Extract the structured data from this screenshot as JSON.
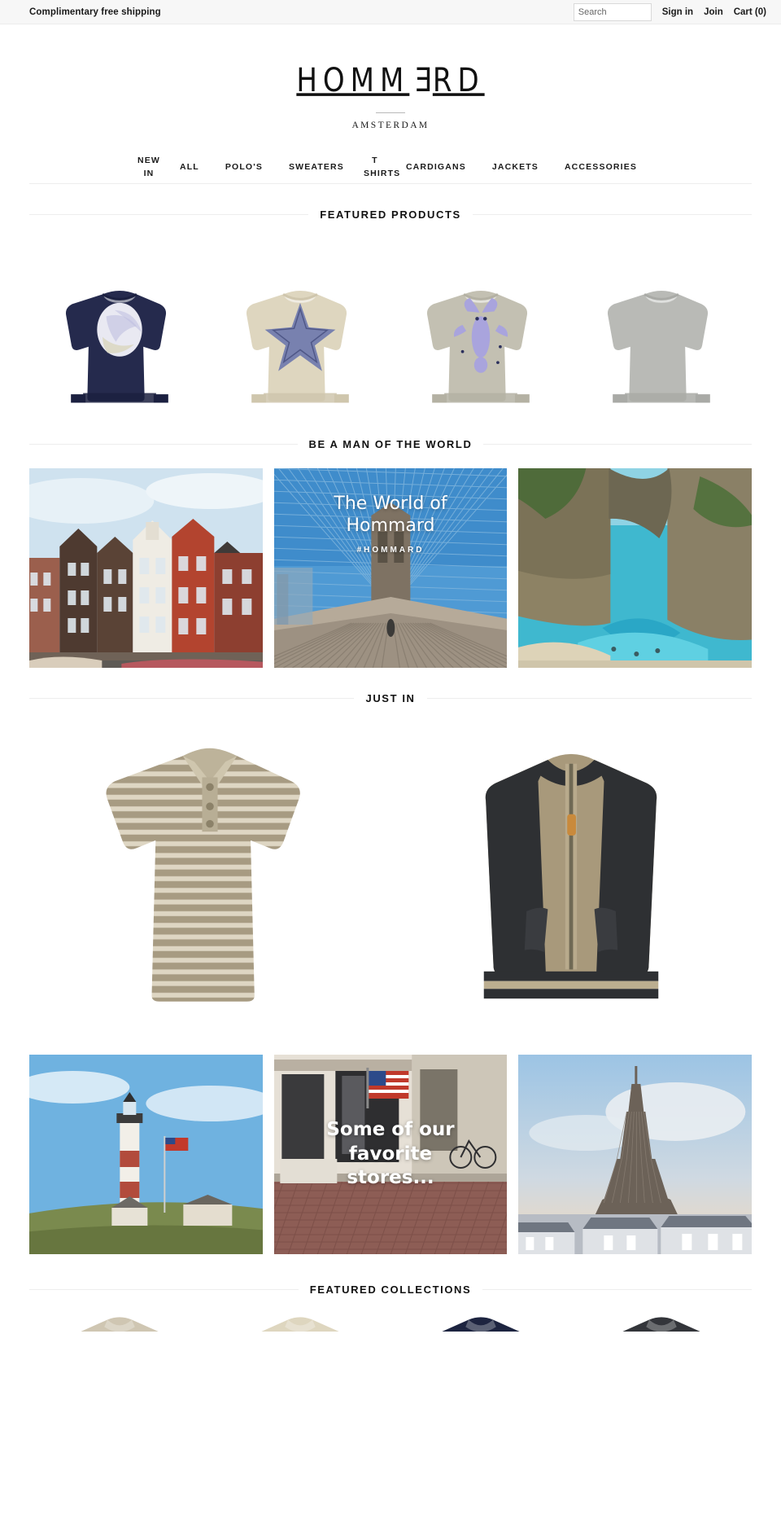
{
  "topbar": {
    "message": "Complimentary free shipping",
    "search_placeholder": "Search",
    "search_value": "",
    "links": [
      {
        "label": "Sign in",
        "name": "sign-in-link"
      },
      {
        "label": "Join",
        "name": "join-link"
      },
      {
        "label": "Cart (0)",
        "name": "cart-link"
      }
    ]
  },
  "brand": {
    "logo_before": "HOMM",
    "logo_flip": "E",
    "logo_after": "RD",
    "tagline": "AMSTERDAM"
  },
  "nav": {
    "items": [
      {
        "label": "NEW IN",
        "two_line": true
      },
      {
        "label": "ALL",
        "two_line": false
      },
      {
        "label": "POLO'S",
        "two_line": false
      },
      {
        "label": "SWEATERS",
        "two_line": false
      },
      {
        "label": "T SHIRTS",
        "two_line": true
      },
      {
        "label": "CARDIGANS",
        "two_line": false
      },
      {
        "label": "JACKETS",
        "two_line": false
      },
      {
        "label": "ACCESSORIES",
        "two_line": false
      }
    ]
  },
  "sections": {
    "featured_products": "FEATURED PRODUCTS",
    "be_a_man": "BE A MAN OF THE WORLD",
    "just_in": "JUST IN",
    "featured_collections": "FEATURED COLLECTIONS"
  },
  "featured_products": [
    {
      "name": "navy-moon-sweater",
      "alt": "Navy crew neck sweater with moon motif",
      "body": "#252a4d",
      "trim": "#1b2040",
      "motif": "moon"
    },
    {
      "name": "cream-starfish-sweater",
      "alt": "Cream crew neck sweater with starfish motif",
      "body": "#ded6bf",
      "trim": "#cfc6ad",
      "motif": "starfish"
    },
    {
      "name": "grey-lobster-sweater",
      "alt": "Grey crew neck sweater with lobster motif",
      "body": "#c3c0b2",
      "trim": "#b4b1a3",
      "motif": "lobster"
    },
    {
      "name": "grey-plain-sweater",
      "alt": "Grey marl plain crew neck sweater",
      "body": "#b9bab6",
      "trim": "#a9aaa6",
      "motif": "none"
    }
  ],
  "world_tiles": [
    {
      "name": "amsterdam-canal-houses",
      "alt": "Amsterdam canal houses",
      "title": "",
      "subtitle": ""
    },
    {
      "name": "brooklyn-bridge",
      "alt": "Brooklyn Bridge walkway",
      "title": "The World of Hommard",
      "subtitle": "#HOMMARD"
    },
    {
      "name": "coastal-arch-beach",
      "alt": "Coastal rock arch with turquoise water",
      "title": "",
      "subtitle": ""
    }
  ],
  "just_in": [
    {
      "name": "striped-polo-shirt",
      "alt": "Beige and cream striped short sleeve polo shirt"
    },
    {
      "name": "two-tone-zip-cardigan",
      "alt": "Tan and charcoal zip bomber cardigan"
    }
  ],
  "store_tiles": [
    {
      "name": "montauk-lighthouse",
      "alt": "Montauk lighthouse with American flag",
      "title": "",
      "subtitle": ""
    },
    {
      "name": "murrays-toggery-shop",
      "alt": "Murray's Toggery Shop storefront with American flag",
      "title": "Some of our favorite stores...",
      "subtitle": ""
    },
    {
      "name": "paris-eiffel-tower",
      "alt": "Eiffel Tower over Paris rooftops",
      "title": "",
      "subtitle": ""
    }
  ],
  "featured_collections": [
    {
      "name": "collection-polo-shirt",
      "alt": "Beige polo shirt collar",
      "body": "#cfc6b2"
    },
    {
      "name": "collection-cream-sweater",
      "alt": "Cream sweater neckline",
      "body": "#ded6bf"
    },
    {
      "name": "collection-navy-item",
      "alt": "Navy knit neckline",
      "body": "#1d2440"
    },
    {
      "name": "collection-charcoal-item",
      "alt": "Charcoal knit neckline",
      "body": "#33353a"
    }
  ],
  "colors": {
    "bar_bg": "#f7f7f7",
    "rule": "#ededed",
    "text": "#1a1a1a"
  }
}
